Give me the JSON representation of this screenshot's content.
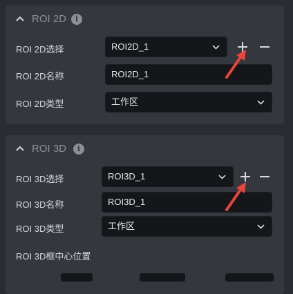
{
  "panel2d": {
    "title": "ROI 2D",
    "rows": [
      {
        "label": "ROI 2D选择",
        "value": "ROI2D_1"
      },
      {
        "label": "ROI 2D名称",
        "value": "ROI2D_1"
      },
      {
        "label": "ROI 2D类型",
        "value": "工作区"
      }
    ]
  },
  "panel3d": {
    "title": "ROI 3D",
    "rows": [
      {
        "label": "ROI 3D选择",
        "value": "ROI3D_1"
      },
      {
        "label": "ROI 3D名称",
        "value": "ROI3D_1"
      },
      {
        "label": "ROI 3D类型",
        "value": "工作区"
      }
    ],
    "center_label": "ROI 3D框中心位置"
  },
  "icons": {
    "collapse": "chevron-up-icon",
    "info": "info-icon",
    "add": "plus-icon",
    "remove": "minus-icon",
    "dropdown": "chevron-down-icon",
    "annotation": "red-arrow-icon"
  },
  "colors": {
    "background": "#2a2c31",
    "panel": "#35373e",
    "field": "#15161a",
    "text": "#d7d9de",
    "muted": "#8b8f98",
    "annotation_arrow": "#e8453c"
  }
}
